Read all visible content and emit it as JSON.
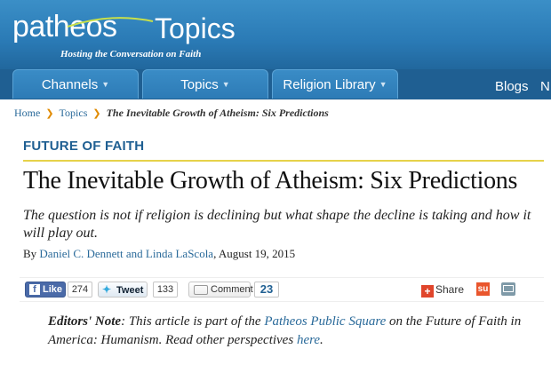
{
  "header": {
    "logo_word": "patheos",
    "logo_topics": "Topics",
    "tagline": "Hosting the Conversation on Faith"
  },
  "nav": {
    "tabs": [
      {
        "label": "Channels"
      },
      {
        "label": "Topics"
      },
      {
        "label": "Religion Library"
      }
    ],
    "links": [
      {
        "label": "Blogs"
      },
      {
        "label": "N"
      }
    ]
  },
  "breadcrumb": {
    "home": "Home",
    "topics": "Topics",
    "current": "The Inevitable Growth of Atheism: Six Predictions"
  },
  "article": {
    "section": "FUTURE OF FAITH",
    "title": "The Inevitable Growth of Atheism: Six Predictions",
    "subtitle": "The question is not if religion is declining but what shape the decline is taking and how it will play out.",
    "by": "By",
    "authors": "Daniel C. Dennett and Linda LaScola",
    "date": ", August 19, 2015"
  },
  "social": {
    "like_label": "Like",
    "like_count": "274",
    "tweet_label": "Tweet",
    "tweet_count": "133",
    "comment_label": "Comment",
    "comment_count": "23",
    "share_label": "Share",
    "icons": [
      "facebook-icon",
      "twitter-icon",
      "comment-icon",
      "addthis-icon",
      "stumbleupon-icon",
      "email-icon"
    ]
  },
  "note": {
    "label": "Editors' Note",
    "text1": ": This article is part of the ",
    "link1": "Patheos Public Square",
    "text2": " on the Future of Faith in America: Humanism. Read other perspectives ",
    "link2": "here",
    "text3": "."
  },
  "colors": {
    "header_blue": "#2a7ab5",
    "nav_dark": "#1f5f92",
    "link_blue": "#2a6a9a",
    "accent_rule": "#e6d24a",
    "breadcrumb_arrow": "#e08a00"
  }
}
